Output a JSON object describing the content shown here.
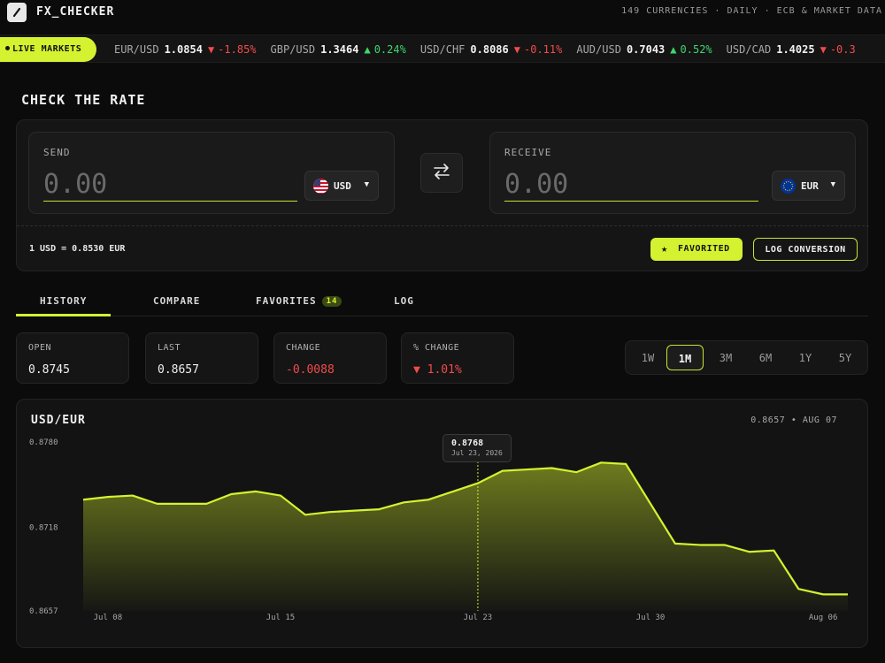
{
  "app": {
    "title": "FX_CHECKER",
    "meta": "149 CURRENCIES · DAILY · ECB & MARKET DATA"
  },
  "ticker": {
    "live_label": "LIVE MARKETS",
    "items": [
      {
        "pair": "EUR/USD",
        "rate": "1.0854",
        "arrow": "▼",
        "change": "-1.85%",
        "dir": "down"
      },
      {
        "pair": "GBP/USD",
        "rate": "1.3464",
        "arrow": "▲",
        "change": "0.24%",
        "dir": "up"
      },
      {
        "pair": "USD/CHF",
        "rate": "0.8086",
        "arrow": "▼",
        "change": "-0.11%",
        "dir": "down"
      },
      {
        "pair": "AUD/USD",
        "rate": "0.7043",
        "arrow": "▲",
        "change": "0.52%",
        "dir": "up"
      },
      {
        "pair": "USD/CAD",
        "rate": "1.4025",
        "arrow": "▼",
        "change": "-0.3",
        "dir": "down"
      }
    ]
  },
  "converter": {
    "section_title": "CHECK THE RATE",
    "send": {
      "label": "SEND",
      "placeholder": "0.00",
      "currency": "USD"
    },
    "receive": {
      "label": "RECEIVE",
      "placeholder": "0.00",
      "currency": "EUR"
    },
    "rate_text": "1 USD = 0.8530 EUR",
    "favorited_label": "FAVORITED",
    "log_label": "LOG CONVERSION"
  },
  "tabs": {
    "history": "HISTORY",
    "compare": "COMPARE",
    "favorites": "FAVORITES",
    "favorites_count": "14",
    "log": "LOG"
  },
  "stats": {
    "open_label": "OPEN",
    "open_value": "0.8745",
    "last_label": "LAST",
    "last_value": "0.8657",
    "change_label": "CHANGE",
    "change_value": "-0.0088",
    "pct_label": "% CHANGE",
    "pct_value": "▼ 1.01%"
  },
  "ranges": [
    "1W",
    "1M",
    "3M",
    "6M",
    "1Y",
    "5Y"
  ],
  "active_range": "1M",
  "chart_header": {
    "pair": "USD/EUR",
    "meta": "0.8657 • AUG 07"
  },
  "tooltip": {
    "value": "0.8768",
    "date": "Jul 23, 2026"
  },
  "colors": {
    "accent": "#d4f230",
    "up": "#3ed66b",
    "down": "#f24b4b",
    "bg": "#0b0b0b"
  },
  "chart_data": {
    "type": "area",
    "series": [
      {
        "values": [
          0.8738,
          0.874,
          0.8741,
          0.8735,
          0.8735,
          0.8735,
          0.8742,
          0.8744,
          0.8741,
          0.8727,
          0.8729,
          0.873,
          0.8731,
          0.8736,
          0.8738,
          0.8744,
          0.875,
          0.8759,
          0.876,
          0.8761,
          0.8758,
          0.8765,
          0.8764,
          0.8735,
          0.8706,
          0.8705,
          0.8705,
          0.87,
          0.8701,
          0.8673,
          0.8669,
          0.8669
        ]
      }
    ],
    "yticks": [
      "0.8780",
      "0.8718",
      "0.8657"
    ],
    "ylim": [
      0.8657,
      0.878
    ],
    "xticks": [
      "Jul 08",
      "Jul 15",
      "Jul 23",
      "Jul 30",
      "Aug 06"
    ],
    "highlight_value": 0.8768
  }
}
